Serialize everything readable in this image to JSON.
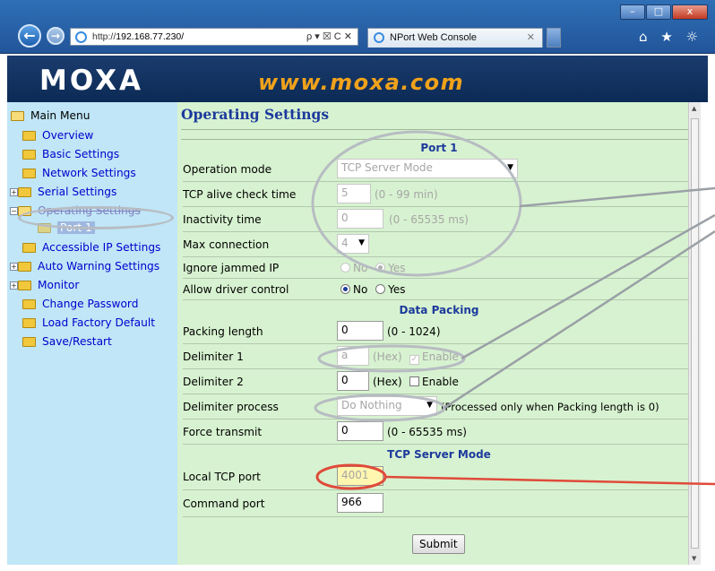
{
  "browser": {
    "url_prefix": "http://",
    "url_host": "192.168.77.230/",
    "address_controls": "ρ ▾ ☒ C ✕",
    "tab_title": "NPort Web Console",
    "tab_close": "✕",
    "tools": "⌂ ★ ☼"
  },
  "banner": {
    "logo": "MOXA",
    "site": "www.moxa.com"
  },
  "menu": {
    "root": "Main Menu",
    "items": [
      {
        "label": "Overview"
      },
      {
        "label": "Basic Settings"
      },
      {
        "label": "Network Settings"
      },
      {
        "label": "Serial Settings"
      },
      {
        "label": "Operating Settings"
      },
      {
        "label": "Port 1"
      },
      {
        "label": "Accessible IP Settings"
      },
      {
        "label": "Auto Warning Settings"
      },
      {
        "label": "Monitor"
      },
      {
        "label": "Change Password"
      },
      {
        "label": "Load Factory Default"
      },
      {
        "label": "Save/Restart"
      }
    ]
  },
  "content": {
    "title": "Operating Settings",
    "port_header": "Port 1",
    "rows": {
      "operation_mode": {
        "label": "Operation mode",
        "value": "TCP Server Mode"
      },
      "tcp_alive": {
        "label": "TCP alive check time",
        "value": "5",
        "hint": "(0 - 99 min)"
      },
      "inactivity": {
        "label": "Inactivity time",
        "value": "0",
        "hint": "(0 - 65535 ms)"
      },
      "max_connection": {
        "label": "Max connection",
        "value": "4"
      },
      "ignore_jammed": {
        "label": "Ignore jammed IP",
        "opt_no": "No",
        "opt_yes": "Yes"
      },
      "allow_driver": {
        "label": "Allow driver control",
        "opt_no": "No",
        "opt_yes": "Yes"
      }
    },
    "data_packing_header": "Data Packing",
    "packing": {
      "packing_length": {
        "label": "Packing length",
        "value": "0",
        "hint": "(0 - 1024)"
      },
      "delimiter1": {
        "label": "Delimiter 1",
        "value": "a",
        "hex": "(Hex)",
        "enable": "Enable"
      },
      "delimiter2": {
        "label": "Delimiter 2",
        "value": "0",
        "hex": "(Hex)",
        "enable": "Enable"
      },
      "delimiter_process": {
        "label": "Delimiter process",
        "value": "Do Nothing",
        "hint": "(Processed only when Packing length is 0)"
      },
      "force_transmit": {
        "label": "Force transmit",
        "value": "0",
        "hint": "(0 - 65535 ms)"
      }
    },
    "tcp_server_header": "TCP Server Mode",
    "tcp_server": {
      "local_tcp_port": {
        "label": "Local TCP port",
        "value": "4001"
      },
      "command_port": {
        "label": "Command port",
        "value": "966"
      }
    },
    "submit_label": "Submit"
  },
  "colors": {
    "banner_bg": "#0c2a55",
    "site_text": "#f0a21b",
    "menu_bg": "#c0e6f7",
    "content_bg": "#d7f2d0",
    "section_text": "#1c3a9c",
    "highlight_oval_red": "#e04a3a",
    "annotation_oval_gray": "#b7bcc2"
  }
}
